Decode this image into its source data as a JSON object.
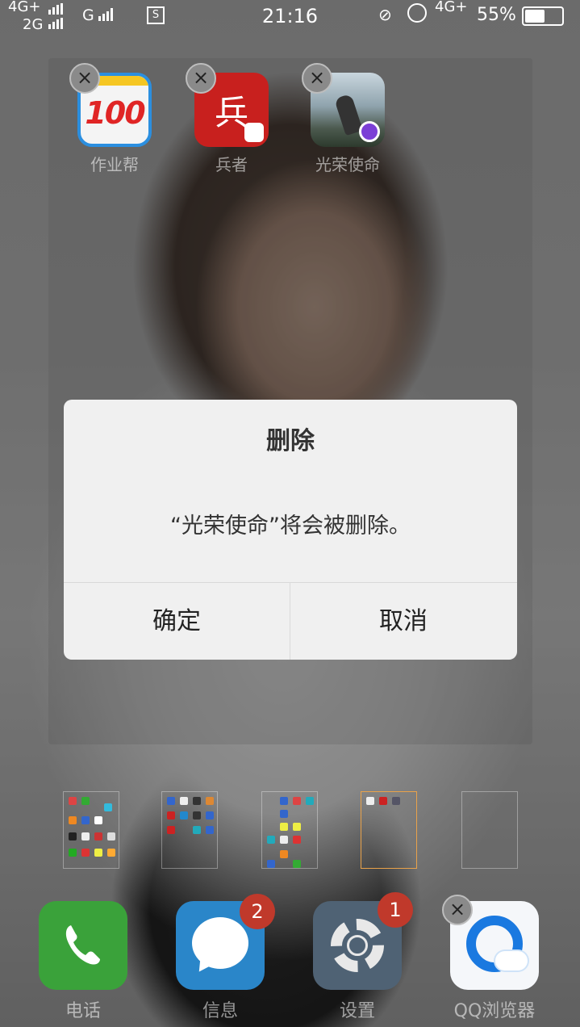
{
  "status_bar": {
    "net_top": "4G+",
    "net_bottom": "2G",
    "carrier_g": "G",
    "time": "21:16",
    "net_right": "4G+",
    "battery_pct": "55%",
    "battery_level": 0.55
  },
  "folder": {
    "apps": [
      {
        "label": "作业帮",
        "icon": "zuoyebang-100-icon",
        "icon_text": "100"
      },
      {
        "label": "兵者",
        "icon": "bingzhe-icon",
        "icon_text": "兵"
      },
      {
        "label": "光荣使命",
        "icon": "guangrong-shiming-icon"
      }
    ]
  },
  "dialog": {
    "title": "删除",
    "message": "“光荣使命”将会被删除。",
    "ok_label": "确定",
    "cancel_label": "取消"
  },
  "pages": {
    "count": 5,
    "active_index": 3
  },
  "dock": [
    {
      "label": "电话",
      "icon": "phone-icon"
    },
    {
      "label": "信息",
      "icon": "message-icon",
      "badge": "2"
    },
    {
      "label": "设置",
      "icon": "settings-icon",
      "badge": "1"
    },
    {
      "label": "QQ浏览器",
      "icon": "qq-browser-icon"
    }
  ],
  "colors": {
    "dialog_bg": "#f0f0f0",
    "badge_red": "#c0392b",
    "active_page_border": "#e9a24a"
  }
}
